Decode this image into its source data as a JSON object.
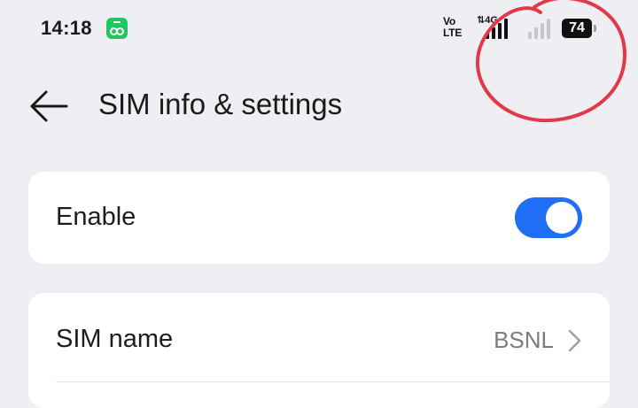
{
  "status_bar": {
    "time": "14:18",
    "notification_icon": "app-notification-icon",
    "volte_line1": "Vo",
    "volte_line2": "LTE",
    "network_type": "4G",
    "battery_percent": "74",
    "sim1_signal_icon": "signal-strong-icon",
    "sim2_signal_icon": "signal-weak-icon"
  },
  "header": {
    "back_icon": "arrow-left-icon",
    "title": "SIM info & settings"
  },
  "enable_card": {
    "label": "Enable",
    "toggle_on": true,
    "toggle_color": "#1f6ef5"
  },
  "sim_card": {
    "name_label": "SIM name",
    "name_value": "BSNL",
    "chevron_icon": "chevron-right-icon"
  },
  "annotation": {
    "color": "#e0394a",
    "shape": "hand-drawn-circle"
  }
}
